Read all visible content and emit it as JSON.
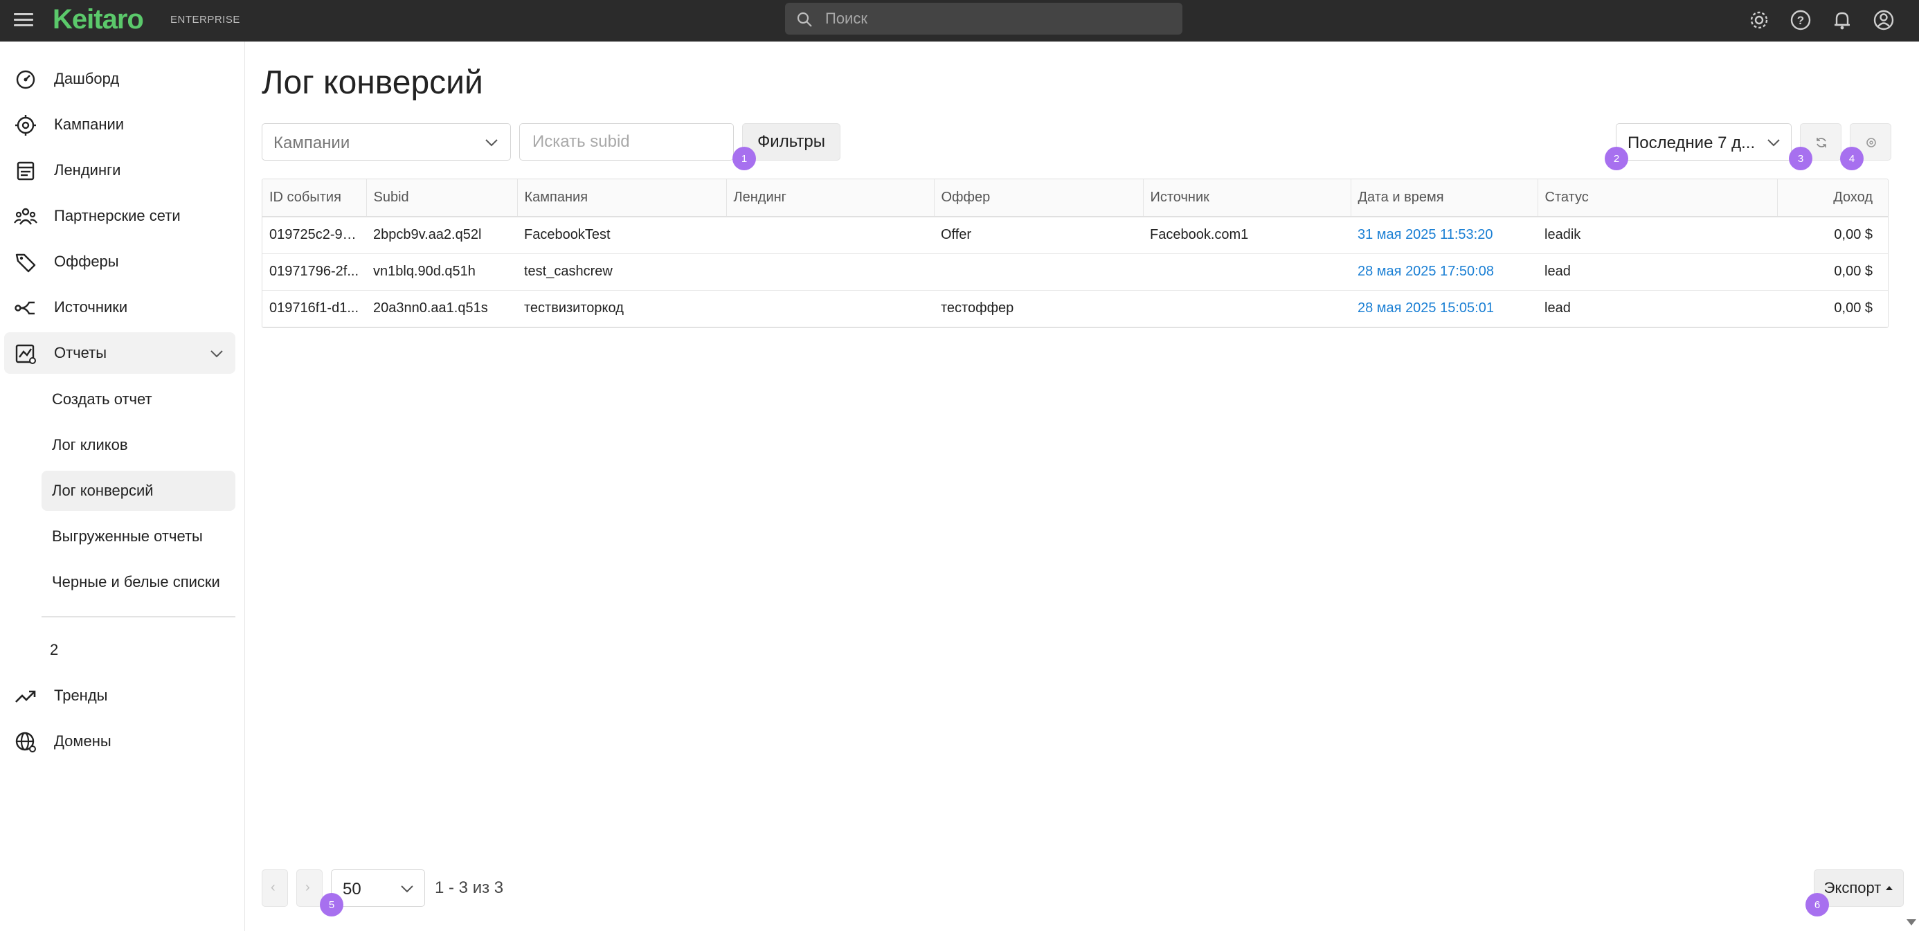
{
  "header": {
    "logo": "Keitaro",
    "edition": "ENTERPRISE",
    "search_placeholder": "Поиск",
    "icons": [
      "gear-icon",
      "help-icon",
      "bell-icon",
      "account-icon"
    ]
  },
  "sidebar": {
    "items": [
      {
        "label": "Дашборд",
        "icon": "dashboard-icon"
      },
      {
        "label": "Кампании",
        "icon": "target-icon"
      },
      {
        "label": "Лендинги",
        "icon": "landing-icon"
      },
      {
        "label": "Партнерские сети",
        "icon": "people-icon"
      },
      {
        "label": "Офферы",
        "icon": "tag-icon"
      },
      {
        "label": "Источники",
        "icon": "source-icon"
      },
      {
        "label": "Отчеты",
        "icon": "report-icon"
      }
    ],
    "reports_sub": [
      {
        "label": "Создать отчет"
      },
      {
        "label": "Лог кликов"
      },
      {
        "label": "Лог конверсий"
      },
      {
        "label": "Выгруженные отчеты"
      },
      {
        "label": "Черные и белые списки"
      }
    ],
    "extra_number": "2",
    "bottom_items": [
      {
        "label": "Тренды",
        "icon": "trend-icon"
      },
      {
        "label": "Домены",
        "icon": "globe-icon"
      }
    ]
  },
  "page": {
    "title": "Лог конверсий",
    "campaign_select": "Кампании",
    "subid_placeholder": "Искать subid",
    "filters_label": "Фильтры",
    "period_select": "Последние 7 д...",
    "badges": [
      "1",
      "2",
      "3",
      "4",
      "5",
      "6"
    ]
  },
  "table": {
    "columns": [
      "ID события",
      "Subid",
      "Кампания",
      "Лендинг",
      "Оффер",
      "Источник",
      "Дата и время",
      "Статус",
      "Доход"
    ],
    "rows": [
      [
        "019725c2-9a...",
        "2bpcb9v.aa2.q52l",
        "FacebookTest",
        "",
        "Offer",
        "Facebook.com1",
        "31 мая 2025 11:53:20",
        "leadik",
        "0,00 $"
      ],
      [
        "01971796-2f...",
        "vn1blq.90d.q51h",
        "test_cashcrew",
        "",
        "",
        "",
        "28 мая 2025 17:50:08",
        "lead",
        "0,00 $"
      ],
      [
        "019716f1-d1...",
        "20a3nn0.aa1.q51s",
        "тествизиторкод",
        "",
        "тестоффер",
        "",
        "28 мая 2025 15:05:01",
        "lead",
        "0,00 $"
      ]
    ]
  },
  "footer": {
    "prev": "‹",
    "next": "›",
    "per_page": "50",
    "range": "1 - 3 из 3",
    "export_label": "Экспорт"
  },
  "colors": {
    "accent": "#5bc96b",
    "badge": "#a770ef",
    "link": "#1a7fd4",
    "topbar": "#2b2b2b"
  }
}
